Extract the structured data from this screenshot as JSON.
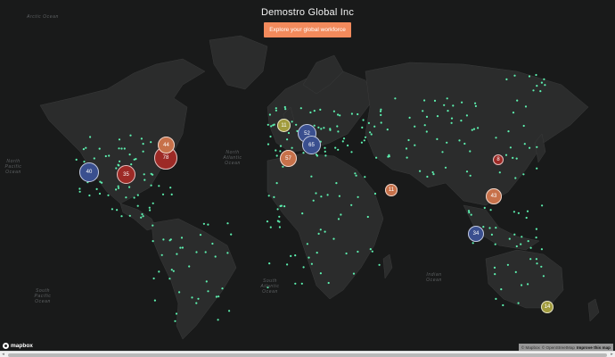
{
  "header": {
    "title": "Demostro Global Inc",
    "button_label": "Explore your global workforce"
  },
  "oceans": [
    {
      "key": "north_pacific",
      "text": "North Pacific Ocean"
    },
    {
      "key": "north_atlantic",
      "text": "North Atlantic Ocean"
    },
    {
      "key": "south_atlantic",
      "text": "South Atlantic Ocean"
    },
    {
      "key": "south_pacific",
      "text": "South Pacific Ocean"
    },
    {
      "key": "indian",
      "text": "Indian Ocean"
    },
    {
      "key": "arctic",
      "text": "Arctic Ocean"
    }
  ],
  "clusters": [
    {
      "key": "us_west",
      "count": "40",
      "color": "#3a4f8f"
    },
    {
      "key": "us_central",
      "count": "35",
      "color": "#9d2a26"
    },
    {
      "key": "us_east",
      "count": "78",
      "color": "#9d2a26"
    },
    {
      "key": "canada_east",
      "count": "44",
      "color": "#c7714a"
    },
    {
      "key": "uk",
      "count": "11",
      "color": "#a19b3d"
    },
    {
      "key": "europe_west",
      "count": "52",
      "color": "#3a4f8f"
    },
    {
      "key": "europe_central",
      "count": "65",
      "color": "#3a4f8f"
    },
    {
      "key": "iberia",
      "count": "57",
      "color": "#c7714a"
    },
    {
      "key": "india",
      "count": "11",
      "color": "#c7714a"
    },
    {
      "key": "japan",
      "count": "8",
      "color": "#9d2a26"
    },
    {
      "key": "east_asia",
      "count": "43",
      "color": "#c7714a"
    },
    {
      "key": "southeast_asia",
      "count": "34",
      "color": "#3a4f8f"
    },
    {
      "key": "australia",
      "count": "14",
      "color": "#a19b3d"
    }
  ],
  "colors": {
    "marker": "#5df2b0",
    "button": "#f28a5c",
    "land": "#2a2b2b",
    "water": "#191a1a"
  },
  "attribution": {
    "mapbox": "© Mapbox",
    "osm": "© OpenStreetMap",
    "improve": "Improve this map"
  },
  "logo": {
    "text": "mapbox"
  }
}
